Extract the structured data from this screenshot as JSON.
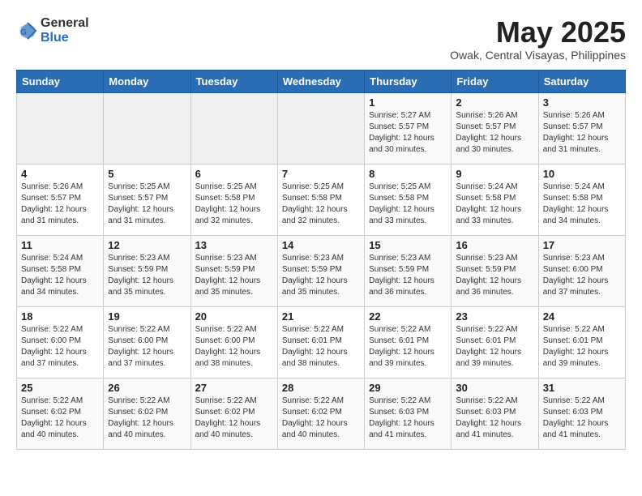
{
  "header": {
    "logo_general": "General",
    "logo_blue": "Blue",
    "month_title": "May 2025",
    "subtitle": "Owak, Central Visayas, Philippines"
  },
  "days_of_week": [
    "Sunday",
    "Monday",
    "Tuesday",
    "Wednesday",
    "Thursday",
    "Friday",
    "Saturday"
  ],
  "weeks": [
    [
      {
        "day": "",
        "info": ""
      },
      {
        "day": "",
        "info": ""
      },
      {
        "day": "",
        "info": ""
      },
      {
        "day": "",
        "info": ""
      },
      {
        "day": "1",
        "info": "Sunrise: 5:27 AM\nSunset: 5:57 PM\nDaylight: 12 hours\nand 30 minutes."
      },
      {
        "day": "2",
        "info": "Sunrise: 5:26 AM\nSunset: 5:57 PM\nDaylight: 12 hours\nand 30 minutes."
      },
      {
        "day": "3",
        "info": "Sunrise: 5:26 AM\nSunset: 5:57 PM\nDaylight: 12 hours\nand 31 minutes."
      }
    ],
    [
      {
        "day": "4",
        "info": "Sunrise: 5:26 AM\nSunset: 5:57 PM\nDaylight: 12 hours\nand 31 minutes."
      },
      {
        "day": "5",
        "info": "Sunrise: 5:25 AM\nSunset: 5:57 PM\nDaylight: 12 hours\nand 31 minutes."
      },
      {
        "day": "6",
        "info": "Sunrise: 5:25 AM\nSunset: 5:58 PM\nDaylight: 12 hours\nand 32 minutes."
      },
      {
        "day": "7",
        "info": "Sunrise: 5:25 AM\nSunset: 5:58 PM\nDaylight: 12 hours\nand 32 minutes."
      },
      {
        "day": "8",
        "info": "Sunrise: 5:25 AM\nSunset: 5:58 PM\nDaylight: 12 hours\nand 33 minutes."
      },
      {
        "day": "9",
        "info": "Sunrise: 5:24 AM\nSunset: 5:58 PM\nDaylight: 12 hours\nand 33 minutes."
      },
      {
        "day": "10",
        "info": "Sunrise: 5:24 AM\nSunset: 5:58 PM\nDaylight: 12 hours\nand 34 minutes."
      }
    ],
    [
      {
        "day": "11",
        "info": "Sunrise: 5:24 AM\nSunset: 5:58 PM\nDaylight: 12 hours\nand 34 minutes."
      },
      {
        "day": "12",
        "info": "Sunrise: 5:23 AM\nSunset: 5:59 PM\nDaylight: 12 hours\nand 35 minutes."
      },
      {
        "day": "13",
        "info": "Sunrise: 5:23 AM\nSunset: 5:59 PM\nDaylight: 12 hours\nand 35 minutes."
      },
      {
        "day": "14",
        "info": "Sunrise: 5:23 AM\nSunset: 5:59 PM\nDaylight: 12 hours\nand 35 minutes."
      },
      {
        "day": "15",
        "info": "Sunrise: 5:23 AM\nSunset: 5:59 PM\nDaylight: 12 hours\nand 36 minutes."
      },
      {
        "day": "16",
        "info": "Sunrise: 5:23 AM\nSunset: 5:59 PM\nDaylight: 12 hours\nand 36 minutes."
      },
      {
        "day": "17",
        "info": "Sunrise: 5:23 AM\nSunset: 6:00 PM\nDaylight: 12 hours\nand 37 minutes."
      }
    ],
    [
      {
        "day": "18",
        "info": "Sunrise: 5:22 AM\nSunset: 6:00 PM\nDaylight: 12 hours\nand 37 minutes."
      },
      {
        "day": "19",
        "info": "Sunrise: 5:22 AM\nSunset: 6:00 PM\nDaylight: 12 hours\nand 37 minutes."
      },
      {
        "day": "20",
        "info": "Sunrise: 5:22 AM\nSunset: 6:00 PM\nDaylight: 12 hours\nand 38 minutes."
      },
      {
        "day": "21",
        "info": "Sunrise: 5:22 AM\nSunset: 6:01 PM\nDaylight: 12 hours\nand 38 minutes."
      },
      {
        "day": "22",
        "info": "Sunrise: 5:22 AM\nSunset: 6:01 PM\nDaylight: 12 hours\nand 39 minutes."
      },
      {
        "day": "23",
        "info": "Sunrise: 5:22 AM\nSunset: 6:01 PM\nDaylight: 12 hours\nand 39 minutes."
      },
      {
        "day": "24",
        "info": "Sunrise: 5:22 AM\nSunset: 6:01 PM\nDaylight: 12 hours\nand 39 minutes."
      }
    ],
    [
      {
        "day": "25",
        "info": "Sunrise: 5:22 AM\nSunset: 6:02 PM\nDaylight: 12 hours\nand 40 minutes."
      },
      {
        "day": "26",
        "info": "Sunrise: 5:22 AM\nSunset: 6:02 PM\nDaylight: 12 hours\nand 40 minutes."
      },
      {
        "day": "27",
        "info": "Sunrise: 5:22 AM\nSunset: 6:02 PM\nDaylight: 12 hours\nand 40 minutes."
      },
      {
        "day": "28",
        "info": "Sunrise: 5:22 AM\nSunset: 6:02 PM\nDaylight: 12 hours\nand 40 minutes."
      },
      {
        "day": "29",
        "info": "Sunrise: 5:22 AM\nSunset: 6:03 PM\nDaylight: 12 hours\nand 41 minutes."
      },
      {
        "day": "30",
        "info": "Sunrise: 5:22 AM\nSunset: 6:03 PM\nDaylight: 12 hours\nand 41 minutes."
      },
      {
        "day": "31",
        "info": "Sunrise: 5:22 AM\nSunset: 6:03 PM\nDaylight: 12 hours\nand 41 minutes."
      }
    ]
  ]
}
